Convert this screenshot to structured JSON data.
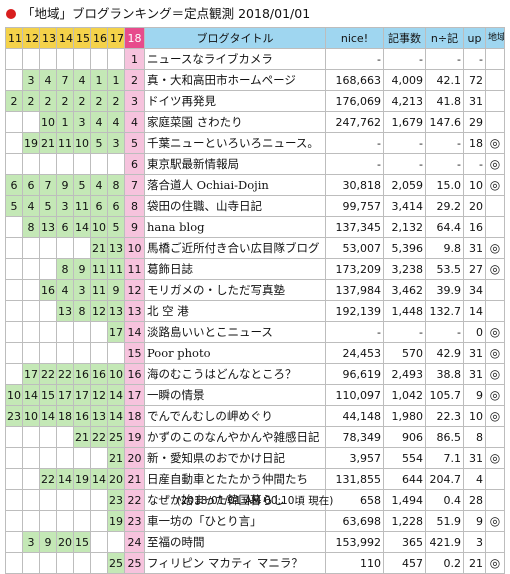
{
  "header": {
    "title": "「地域」ブログランキング＝定点観測 2018/01/01"
  },
  "columns": {
    "history": [
      "11",
      "12",
      "13",
      "14",
      "15",
      "16",
      "17"
    ],
    "current": "18",
    "blog_title": "ブログタイトル",
    "nice": "nice!",
    "articles": "記事数",
    "nice_per_article": "n÷記",
    "up": "up",
    "region": "地域"
  },
  "rows": [
    {
      "rank": "1",
      "history": [
        "",
        "",
        "",
        "",
        "",
        "",
        ""
      ],
      "name": "ニュースなライブカメラ",
      "nice": "-",
      "articles": "-",
      "ratio": "-",
      "up": "-",
      "region": ""
    },
    {
      "rank": "2",
      "history": [
        "",
        "3",
        "4",
        "7",
        "4",
        "1",
        "1"
      ],
      "name": "真・大和高田市ホームページ",
      "nice": "168,663",
      "articles": "4,009",
      "ratio": "42.1",
      "up": "72",
      "region": ""
    },
    {
      "rank": "3",
      "history": [
        "2",
        "2",
        "2",
        "2",
        "2",
        "2",
        "2"
      ],
      "name": "ドイツ再発見",
      "nice": "176,069",
      "articles": "4,213",
      "ratio": "41.8",
      "up": "31",
      "region": ""
    },
    {
      "rank": "4",
      "history": [
        "",
        "",
        "10",
        "1",
        "3",
        "4",
        "4"
      ],
      "name": "家庭菜園 さわたり",
      "nice": "247,762",
      "articles": "1,679",
      "ratio": "147.6",
      "up": "29",
      "region": ""
    },
    {
      "rank": "5",
      "history": [
        "",
        "19",
        "21",
        "11",
        "10",
        "5",
        "3"
      ],
      "name": "千葉ニューといろいろニュース。",
      "nice": "-",
      "articles": "-",
      "ratio": "-",
      "up": "18",
      "region": "◎"
    },
    {
      "rank": "6",
      "history": [
        "",
        "",
        "",
        "",
        "",
        "",
        ""
      ],
      "name": "東京駅最新情報局",
      "nice": "-",
      "articles": "-",
      "ratio": "-",
      "up": "-",
      "region": "◎"
    },
    {
      "rank": "7",
      "history": [
        "6",
        "6",
        "7",
        "9",
        "5",
        "4",
        "8"
      ],
      "name": "落合道人 Ochiai-Dojin",
      "nice": "30,818",
      "articles": "2,059",
      "ratio": "15.0",
      "up": "10",
      "region": "◎"
    },
    {
      "rank": "8",
      "history": [
        "5",
        "4",
        "5",
        "3",
        "11",
        "6",
        "6"
      ],
      "name": "袋田の住職、山寺日記",
      "nice": "99,757",
      "articles": "3,414",
      "ratio": "29.2",
      "up": "20",
      "region": ""
    },
    {
      "rank": "9",
      "history": [
        "",
        "8",
        "13",
        "6",
        "14",
        "10",
        "5"
      ],
      "name": "hana blog",
      "nice": "137,345",
      "articles": "2,132",
      "ratio": "64.4",
      "up": "16",
      "region": ""
    },
    {
      "rank": "10",
      "history": [
        "",
        "",
        "",
        "",
        "",
        "21",
        "13"
      ],
      "name": "馬橋ご近所付き合い広目隊ブログ",
      "nice": "53,007",
      "articles": "5,396",
      "ratio": "9.8",
      "up": "31",
      "region": "◎"
    },
    {
      "rank": "11",
      "history": [
        "",
        "",
        "",
        "8",
        "9",
        "11",
        "11"
      ],
      "name": "葛飾日誌",
      "nice": "173,209",
      "articles": "3,238",
      "ratio": "53.5",
      "up": "27",
      "region": "◎"
    },
    {
      "rank": "12",
      "history": [
        "",
        "",
        "16",
        "4",
        "3",
        "11",
        "9"
      ],
      "name": "モリガメの・しただ写真塾",
      "nice": "137,984",
      "articles": "3,462",
      "ratio": "39.9",
      "up": "34",
      "region": ""
    },
    {
      "rank": "13",
      "history": [
        "",
        "",
        "",
        "13",
        "8",
        "12",
        "13"
      ],
      "name": "北 空 港",
      "nice": "192,139",
      "articles": "1,448",
      "ratio": "132.7",
      "up": "14",
      "region": ""
    },
    {
      "rank": "14",
      "history": [
        "",
        "",
        "",
        "",
        "",
        "",
        "17"
      ],
      "name": "淡路島いいとこニュース",
      "nice": "-",
      "articles": "-",
      "ratio": "-",
      "up": "0",
      "region": "◎"
    },
    {
      "rank": "15",
      "history": [
        "",
        "",
        "",
        "",
        "",
        "",
        ""
      ],
      "name": "Poor photo",
      "nice": "24,453",
      "articles": "570",
      "ratio": "42.9",
      "up": "31",
      "region": "◎"
    },
    {
      "rank": "16",
      "history": [
        "",
        "17",
        "22",
        "22",
        "16",
        "16",
        "10"
      ],
      "name": "海のむこうはどんなところ？",
      "nice": "96,619",
      "articles": "2,493",
      "ratio": "38.8",
      "up": "31",
      "region": "◎"
    },
    {
      "rank": "17",
      "history": [
        "10",
        "14",
        "15",
        "17",
        "17",
        "12",
        "14"
      ],
      "name": "一瞬の情景",
      "nice": "110,097",
      "articles": "1,042",
      "ratio": "105.7",
      "up": "9",
      "region": "◎"
    },
    {
      "rank": "18",
      "history": [
        "23",
        "10",
        "14",
        "18",
        "16",
        "13",
        "14"
      ],
      "name": "でんでんむしの岬めぐり",
      "nice": "44,148",
      "articles": "1,980",
      "ratio": "22.3",
      "up": "10",
      "region": "◎"
    },
    {
      "rank": "19",
      "history": [
        "",
        "",
        "",
        "",
        "21",
        "22",
        "25"
      ],
      "name": "かずのこのなんやかんや雑感日記",
      "nice": "78,349",
      "articles": "906",
      "ratio": "86.5",
      "up": "8",
      "region": ""
    },
    {
      "rank": "20",
      "history": [
        "",
        "",
        "",
        "",
        "",
        "",
        "21"
      ],
      "name": "新・愛知県のおでかけ日記",
      "nice": "3,957",
      "articles": "554",
      "ratio": "7.1",
      "up": "31",
      "region": "◎"
    },
    {
      "rank": "21",
      "history": [
        "",
        "",
        "22",
        "14",
        "19",
        "14",
        "20"
      ],
      "name": "日産自動車とたたかう仲間たち",
      "nice": "131,855",
      "articles": "644",
      "ratio": "204.7",
      "up": "4",
      "region": ""
    },
    {
      "rank": "22",
      "history": [
        "",
        "",
        "",
        "",
        "",
        "",
        "23"
      ],
      "name": "なぜか始まった韓国暮らし",
      "nice": "658",
      "articles": "1,494",
      "ratio": "0.4",
      "up": "28",
      "region": ""
    },
    {
      "rank": "23",
      "history": [
        "",
        "",
        "",
        "",
        "",
        "",
        "19"
      ],
      "name": "車一坊の「ひとり言」",
      "nice": "63,698",
      "articles": "1,228",
      "ratio": "51.9",
      "up": "9",
      "region": "◎"
    },
    {
      "rank": "24",
      "history": [
        "",
        "3",
        "9",
        "20",
        "15",
        "",
        ""
      ],
      "name": "至福の時間",
      "nice": "153,992",
      "articles": "365",
      "ratio": "421.9",
      "up": "3",
      "region": ""
    },
    {
      "rank": "25",
      "history": [
        "",
        "",
        "",
        "",
        "",
        "",
        "25"
      ],
      "name": "フィリピン マカティ マニラ？",
      "nice": "110",
      "articles": "457",
      "ratio": "0.2",
      "up": "21",
      "region": "◎"
    }
  ],
  "footer": {
    "timestamp": "(2018/01/01 AM 00:10頃 現在)"
  },
  "colors": {
    "history_bg": "#c4e8b6",
    "rank_header": "#e74c8c",
    "rank_cell": "#f6c3dd",
    "header_main": "#9fd6f0",
    "header_history": "#f4d24a"
  }
}
